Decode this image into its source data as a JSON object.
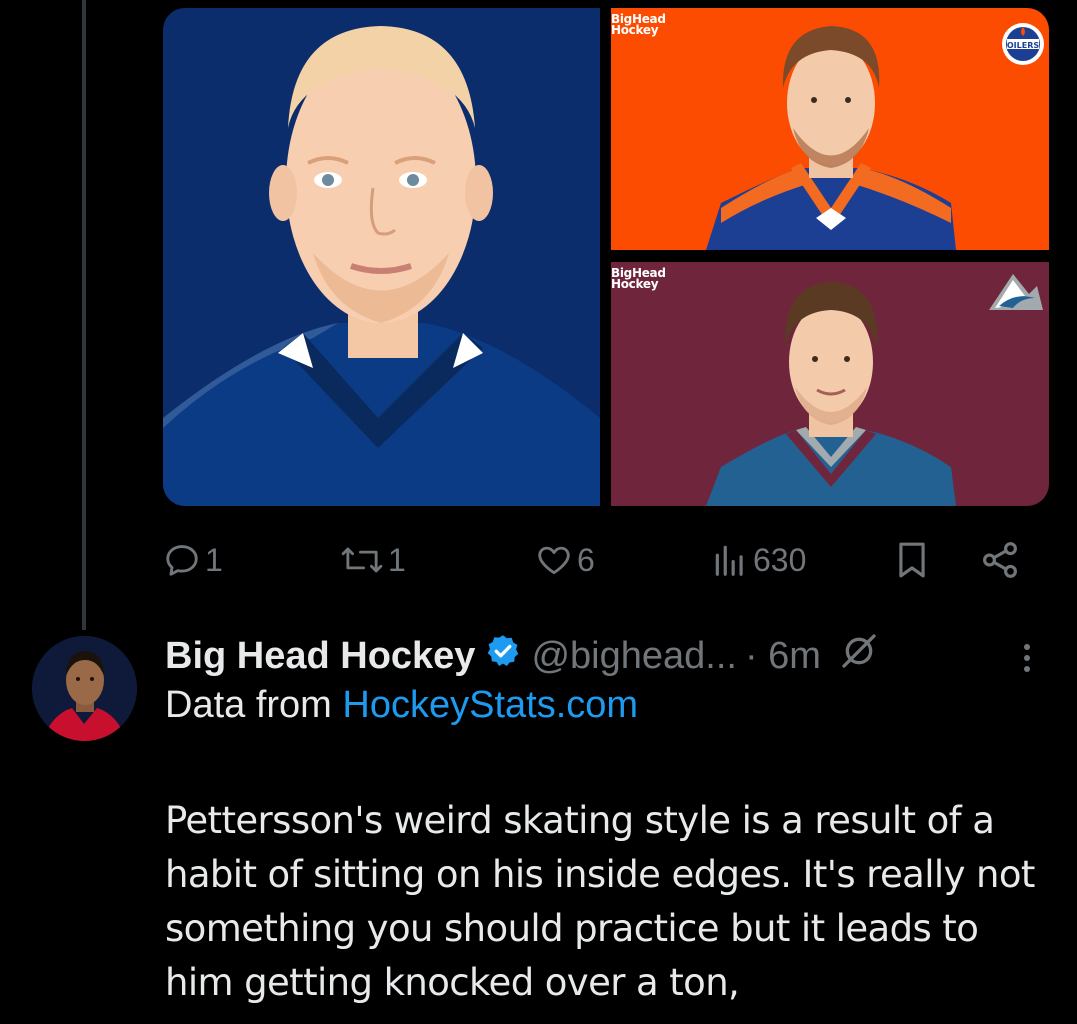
{
  "media": {
    "watermark_line1": "BigHead",
    "watermark_line2": "Hockey",
    "team_top_logo_text": "OILERS",
    "colors": {
      "left_bg": "#0c2d6b",
      "top_right_bg": "#fc4c02",
      "bottom_right_bg": "#6f263d"
    },
    "icons": {
      "top_right_logo": "oilers-logo-icon",
      "bottom_right_logo": "avalanche-logo-icon"
    }
  },
  "actions": {
    "reply_count": "1",
    "repost_count": "1",
    "like_count": "6",
    "views_count": "630"
  },
  "tweet": {
    "author_name": "Big Head Hockey",
    "handle": "@bighead...",
    "time": "· 6m",
    "line2_prefix": "Data from ",
    "line2_link": "HockeyStats.com",
    "text": "Pettersson's weird skating style is a result of a habit of sitting on his inside edges. It's really not something you should practice but it leads to him getting knocked over a ton,"
  },
  "colors": {
    "link": "#1d9bf0",
    "muted": "#71767b",
    "text": "#e7e9ea",
    "verified": "#1d9bf0"
  }
}
